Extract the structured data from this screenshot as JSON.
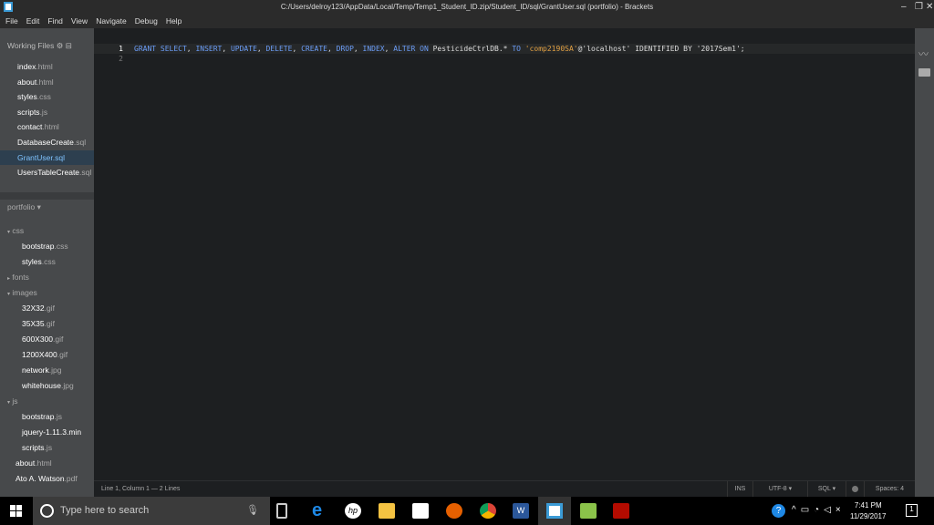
{
  "window": {
    "title": "C:/Users/delroy123/AppData/Local/Temp/Temp1_Student_ID.zip/Student_ID/sql/GrantUser.sql (portfolio) - Brackets"
  },
  "menu": [
    "File",
    "Edit",
    "Find",
    "View",
    "Navigate",
    "Debug",
    "Help"
  ],
  "working_files": {
    "label": "Working Files",
    "items": [
      {
        "name": "index",
        "ext": ".html"
      },
      {
        "name": "about",
        "ext": ".html"
      },
      {
        "name": "styles",
        "ext": ".css"
      },
      {
        "name": "scripts",
        "ext": ".js"
      },
      {
        "name": "contact",
        "ext": ".html"
      },
      {
        "name": "DatabaseCreate",
        "ext": ".sql"
      },
      {
        "name": "GrantUser",
        "ext": ".sql",
        "active": true
      },
      {
        "name": "UsersTableCreate",
        "ext": ".sql"
      }
    ]
  },
  "project": {
    "label": "portfolio",
    "tree": [
      {
        "type": "folder",
        "name": "css",
        "depth": 0,
        "open": true
      },
      {
        "type": "file",
        "name": "bootstrap",
        "ext": ".css",
        "depth": 1
      },
      {
        "type": "file",
        "name": "styles",
        "ext": ".css",
        "depth": 1
      },
      {
        "type": "folder",
        "name": "fonts",
        "depth": 0,
        "open": false
      },
      {
        "type": "folder",
        "name": "images",
        "depth": 0,
        "open": true
      },
      {
        "type": "file",
        "name": "32X32",
        "ext": ".gif",
        "depth": 1
      },
      {
        "type": "file",
        "name": "35X35",
        "ext": ".gif",
        "depth": 1
      },
      {
        "type": "file",
        "name": "600X300",
        "ext": ".gif",
        "depth": 1
      },
      {
        "type": "file",
        "name": "1200X400",
        "ext": ".gif",
        "depth": 1
      },
      {
        "type": "file",
        "name": "network",
        "ext": ".jpg",
        "depth": 1
      },
      {
        "type": "file",
        "name": "whitehouse",
        "ext": ".jpg",
        "depth": 1
      },
      {
        "type": "folder",
        "name": "js",
        "depth": 0,
        "open": true
      },
      {
        "type": "file",
        "name": "bootstrap",
        "ext": ".js",
        "depth": 1
      },
      {
        "type": "file",
        "name": "jquery-1.11.3.min",
        "ext": "",
        "depth": 1
      },
      {
        "type": "file",
        "name": "scripts",
        "ext": ".js",
        "depth": 1
      },
      {
        "type": "file",
        "name": "about",
        "ext": ".html",
        "depth": 0
      },
      {
        "type": "file",
        "name": "Ato A. Watson",
        "ext": ".pdf",
        "depth": 0
      }
    ]
  },
  "editor": {
    "lines": [
      {
        "n": "1",
        "tokens": [
          [
            "kw",
            "GRANT SELECT"
          ],
          [
            "id",
            ", "
          ],
          [
            "kw",
            "INSERT"
          ],
          [
            "id",
            ", "
          ],
          [
            "kw",
            "UPDATE"
          ],
          [
            "id",
            ", "
          ],
          [
            "kw",
            "DELETE"
          ],
          [
            "id",
            ", "
          ],
          [
            "kw",
            "CREATE"
          ],
          [
            "id",
            ", "
          ],
          [
            "kw",
            "DROP"
          ],
          [
            "id",
            ", "
          ],
          [
            "kw",
            "INDEX"
          ],
          [
            "id",
            ", "
          ],
          [
            "kw",
            "ALTER ON"
          ],
          [
            "id",
            " PesticideCtrlDB.* "
          ],
          [
            "kw",
            "TO"
          ],
          [
            "id",
            " "
          ],
          [
            "str",
            "'comp2190SA'"
          ],
          [
            "id",
            "@'localhost' IDENTIFIED BY '2017Sem1';"
          ]
        ]
      },
      {
        "n": "2",
        "tokens": []
      }
    ]
  },
  "status": {
    "position": "Line 1, Column 1 — 2 Lines",
    "mode": "INS",
    "encoding": "UTF-8 ▾",
    "language": "SQL ▾",
    "spaces": "Spaces: 4"
  },
  "taskbar": {
    "search_placeholder": "Type here to search",
    "time": "7:41 PM",
    "date": "11/29/2017",
    "notifications": "1"
  }
}
